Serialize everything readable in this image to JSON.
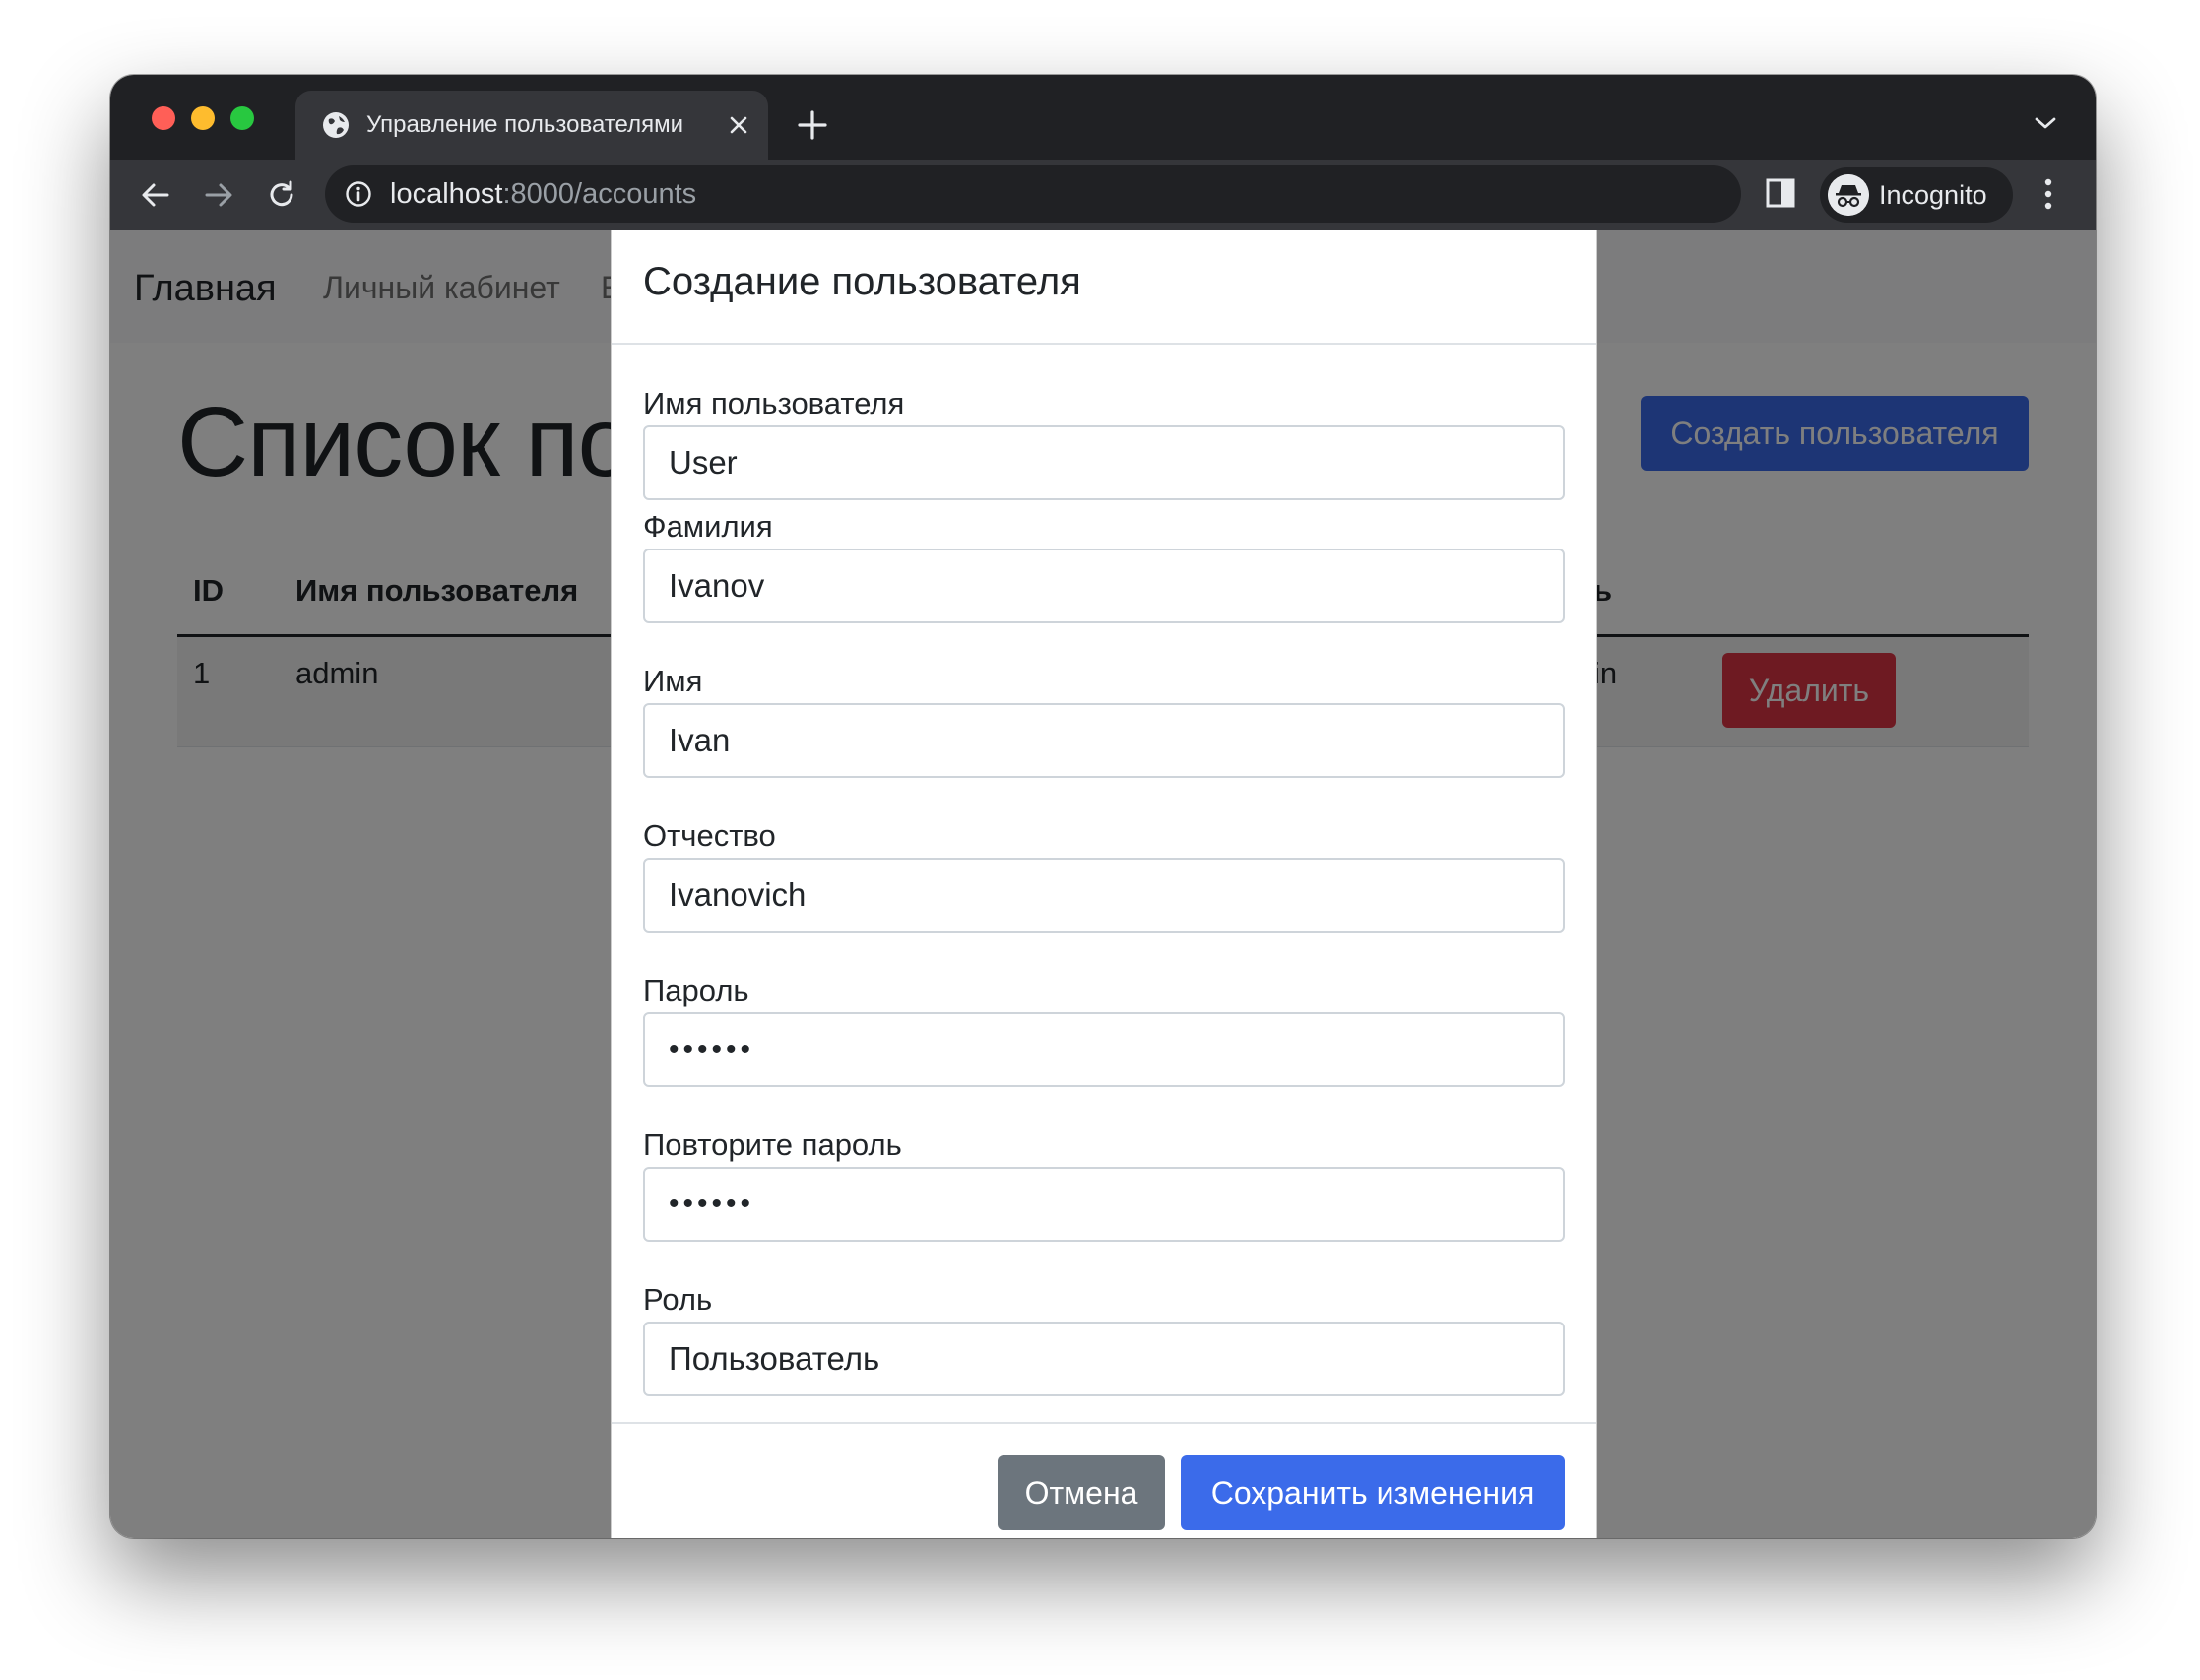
{
  "browser": {
    "tab_title": "Управление пользователями",
    "url_host": "localhost",
    "url_path": ":8000/accounts",
    "profile_label": "Incognito"
  },
  "navbar": {
    "brand": "Главная",
    "links": [
      "Личный кабинет",
      "Е"
    ]
  },
  "page": {
    "heading": "Список по",
    "create_button": "Создать пользователя",
    "table": {
      "headers": [
        "ID",
        "Имя пользователя",
        "ь"
      ],
      "rows": [
        {
          "id": "1",
          "username": "admin",
          "role_fragment": "in",
          "delete_label": "Удалить"
        }
      ]
    }
  },
  "modal": {
    "title": "Создание пользователя",
    "fields": [
      {
        "label": "Имя пользователя",
        "value": "User"
      },
      {
        "label": "Фамилия",
        "value": "Ivanov"
      },
      {
        "label": "Имя",
        "value": "Ivan"
      },
      {
        "label": "Отчество",
        "value": "Ivanovich"
      },
      {
        "label": "Пароль",
        "value": "••••••"
      },
      {
        "label": "Повторите пароль",
        "value": "••••••"
      },
      {
        "label": "Роль",
        "value": "Пользователь"
      }
    ],
    "cancel_label": "Отмена",
    "save_label": "Сохранить изменения"
  },
  "colors": {
    "primary": "#3b6bea",
    "danger": "#dc3545",
    "secondary": "#6c757d",
    "chrome_dark": "#202124",
    "chrome_toolbar": "#35363a"
  }
}
